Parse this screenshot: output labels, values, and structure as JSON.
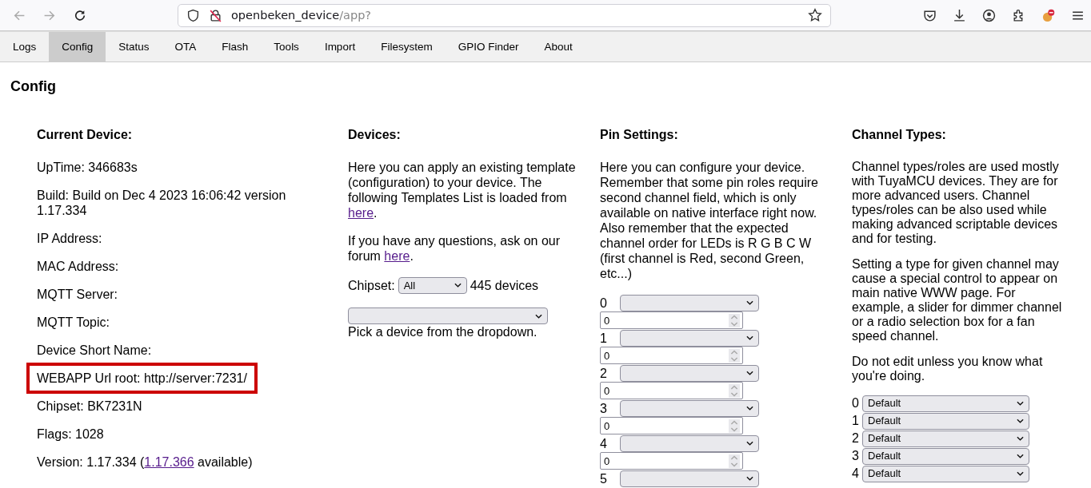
{
  "browser": {
    "back_disabled": true,
    "forward_disabled": true,
    "url_host": "openbeken_device",
    "url_path": "/app?"
  },
  "tabs": [
    {
      "label": "Logs",
      "selected": false
    },
    {
      "label": "Config",
      "selected": true
    },
    {
      "label": "Status",
      "selected": false
    },
    {
      "label": "OTA",
      "selected": false
    },
    {
      "label": "Flash",
      "selected": false
    },
    {
      "label": "Tools",
      "selected": false
    },
    {
      "label": "Import",
      "selected": false
    },
    {
      "label": "Filesystem",
      "selected": false
    },
    {
      "label": "GPIO Finder",
      "selected": false
    },
    {
      "label": "About",
      "selected": false
    }
  ],
  "page_title": "Config",
  "current_device": {
    "heading": "Current Device:",
    "fields": [
      {
        "text": "UpTime: 346683s",
        "highlighted": false
      },
      {
        "text": "Build: Build on Dec 4 2023 16:06:42 version 1.17.334",
        "highlighted": false
      },
      {
        "text": "IP Address:",
        "highlighted": false
      },
      {
        "text": "MAC Address:",
        "highlighted": false
      },
      {
        "text": "MQTT Server:",
        "highlighted": false
      },
      {
        "text": "MQTT Topic:",
        "highlighted": false
      },
      {
        "text": "Device Short Name:",
        "highlighted": false
      },
      {
        "text": "WEBAPP Url root: http://server:7231/",
        "highlighted": true
      },
      {
        "text": "Chipset: BK7231N",
        "highlighted": false
      },
      {
        "text": "Flags: 1028",
        "highlighted": false
      }
    ],
    "version": {
      "prefix": "Version: 1.17.334 (",
      "link": "1.17.366",
      "suffix": " available)"
    }
  },
  "devices": {
    "heading": "Devices:",
    "paragraphs": [
      {
        "text": "Here you can apply an existing template (configuration) to your device. The following Templates List is loaded from ",
        "link": "here",
        "suffix": "."
      },
      {
        "text": "If you have any questions, ask on our forum ",
        "link": "here",
        "suffix": "."
      }
    ],
    "chipset_label": "Chipset:",
    "chipset_value": "All",
    "device_count": "445 devices",
    "hint": "Pick a device from the dropdown."
  },
  "pin_settings": {
    "heading": "Pin Settings:",
    "paragraph": "Here you can configure your device. Remember that some pin roles require second channel field, which is only available on native interface right now. Also remember that the expected channel order for LEDs is R G B C W (first channel is Red, second Green, etc...)",
    "pins": [
      {
        "index": "0",
        "channel": "0"
      },
      {
        "index": "1",
        "channel": "0"
      },
      {
        "index": "2",
        "channel": "0"
      },
      {
        "index": "3",
        "channel": "0"
      },
      {
        "index": "4",
        "channel": "0"
      },
      {
        "index": "5"
      }
    ]
  },
  "channel_types": {
    "heading": "Channel Types:",
    "paragraphs": [
      "Channel types/roles are used mostly with TuyaMCU devices. They are for more advanced users. Channel types/roles can be also used while making advanced scriptable devices and for testing.",
      "Setting a type for given channel may cause a special control to appear on main native WWW page. For example, a slider for dimmer channel or a radio selection box for a fan speed channel.",
      "Do not edit unless you know what you're doing."
    ],
    "channels": [
      {
        "index": "0",
        "type": "Default"
      },
      {
        "index": "1",
        "type": "Default"
      },
      {
        "index": "2",
        "type": "Default"
      },
      {
        "index": "3",
        "type": "Default"
      },
      {
        "index": "4",
        "type": "Default"
      }
    ]
  }
}
